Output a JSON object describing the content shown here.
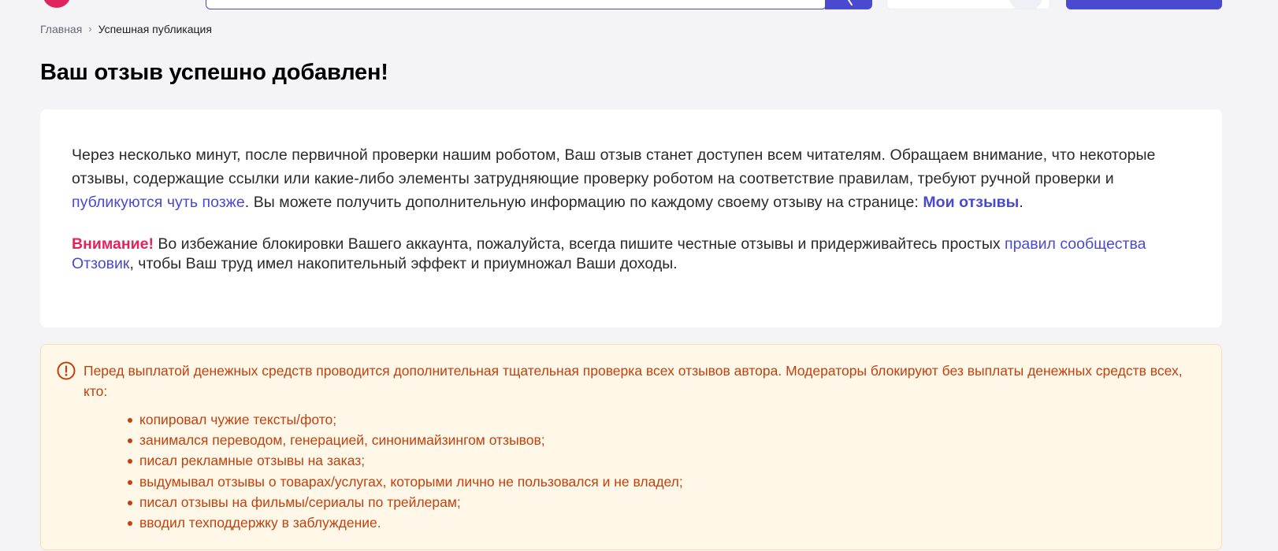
{
  "colors": {
    "accent": "#4a4ad0",
    "brand": "#e0245e",
    "notice_text": "#c2410c",
    "notice_bg": "#fff7e8",
    "page_bg": "#f4f4f6"
  },
  "header": {
    "logo_icon": "otzovik-logo-icon",
    "search_icon": "search-icon"
  },
  "breadcrumb": {
    "home": "Главная",
    "separator": "›",
    "current": "Успешная публикация"
  },
  "page": {
    "title": "Ваш отзыв успешно добавлен!"
  },
  "info": {
    "text_1": "Через несколько минут, после первичной проверки нашим роботом, Ваш отзыв станет доступен всем читателям. Обращаем внимание, что некоторые отзывы, содержащие ссылки или какие-либо элементы затрудняющие проверку роботом на соответствие правилам, требуют ручной проверки и ",
    "later_link": "публикуются чуть позже",
    "text_2": ". Вы можете получить дополнительную информацию по каждому своему отзыву на странице: ",
    "my_reviews_link": "Мои отзывы",
    "text_3": "."
  },
  "warning": {
    "attention": "Внимание!",
    "text_1": " Во избежание блокировки Вашего аккаунта, пожалуйста, всегда пишите честные отзывы и придерживайтесь простых ",
    "rules_link": "правил сообщества Отзовик",
    "text_2": ", чтобы Ваш труд имел накопительный эффект и приумножал Ваши доходы."
  },
  "notice": {
    "icon": "exclamation-circle-icon",
    "text": "Перед выплатой денежных средств проводится дополнительная тщательная проверка всех отзывов автора. Модераторы блокируют без выплаты денежных средств всех, кто:",
    "items": [
      "копировал чужие тексты/фото;",
      "занимался переводом, генерацией, синонимайзингом отзывов;",
      "писал рекламные отзывы на заказ;",
      "выдумывал отзывы о товарах/услугах, которыми лично не пользовался и не владел;",
      "писал отзывы на фильмы/сериалы по трейлерам;",
      "вводил техподдержку в заблуждение."
    ]
  }
}
